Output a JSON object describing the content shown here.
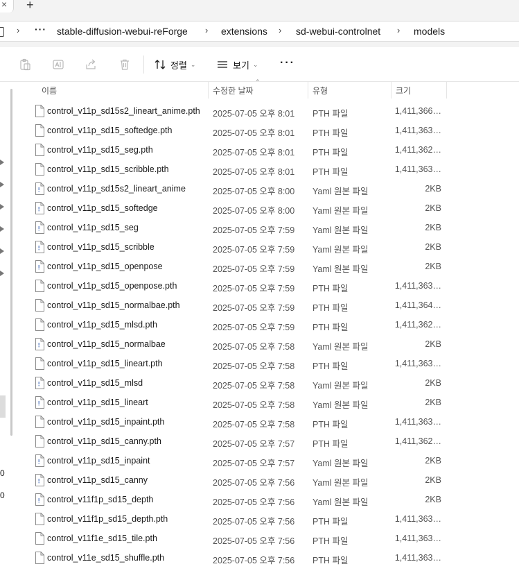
{
  "tabs": {
    "new_tab": "+",
    "close": "×"
  },
  "breadcrumb": {
    "overflow": "···",
    "items": [
      "stable-diffusion-webui-reForge",
      "extensions",
      "sd-webui-controlnet",
      "models"
    ]
  },
  "toolbar": {
    "sort_label": "정렬",
    "view_label": "보기",
    "more": "···"
  },
  "nav": {
    "digits": [
      "0",
      "0"
    ]
  },
  "columns": {
    "name": "이름",
    "date": "수정한 날짜",
    "type": "유형",
    "size": "크기"
  },
  "files": [
    {
      "name": "control_v11p_sd15s2_lineart_anime.pth",
      "date": "2025-07-05 오후 8:01",
      "type": "PTH 파일",
      "size": "1,411,366…",
      "kind": "pth"
    },
    {
      "name": "control_v11p_sd15_softedge.pth",
      "date": "2025-07-05 오후 8:01",
      "type": "PTH 파일",
      "size": "1,411,363…",
      "kind": "pth"
    },
    {
      "name": "control_v11p_sd15_seg.pth",
      "date": "2025-07-05 오후 8:01",
      "type": "PTH 파일",
      "size": "1,411,362…",
      "kind": "pth"
    },
    {
      "name": "control_v11p_sd15_scribble.pth",
      "date": "2025-07-05 오후 8:01",
      "type": "PTH 파일",
      "size": "1,411,363…",
      "kind": "pth"
    },
    {
      "name": "control_v11p_sd15s2_lineart_anime",
      "date": "2025-07-05 오후 8:00",
      "type": "Yaml 원본 파일",
      "size": "2KB",
      "kind": "yaml"
    },
    {
      "name": "control_v11p_sd15_softedge",
      "date": "2025-07-05 오후 8:00",
      "type": "Yaml 원본 파일",
      "size": "2KB",
      "kind": "yaml"
    },
    {
      "name": "control_v11p_sd15_seg",
      "date": "2025-07-05 오후 7:59",
      "type": "Yaml 원본 파일",
      "size": "2KB",
      "kind": "yaml"
    },
    {
      "name": "control_v11p_sd15_scribble",
      "date": "2025-07-05 오후 7:59",
      "type": "Yaml 원본 파일",
      "size": "2KB",
      "kind": "yaml"
    },
    {
      "name": "control_v11p_sd15_openpose",
      "date": "2025-07-05 오후 7:59",
      "type": "Yaml 원본 파일",
      "size": "2KB",
      "kind": "yaml"
    },
    {
      "name": "control_v11p_sd15_openpose.pth",
      "date": "2025-07-05 오후 7:59",
      "type": "PTH 파일",
      "size": "1,411,363…",
      "kind": "pth"
    },
    {
      "name": "control_v11p_sd15_normalbae.pth",
      "date": "2025-07-05 오후 7:59",
      "type": "PTH 파일",
      "size": "1,411,364…",
      "kind": "pth"
    },
    {
      "name": "control_v11p_sd15_mlsd.pth",
      "date": "2025-07-05 오후 7:59",
      "type": "PTH 파일",
      "size": "1,411,362…",
      "kind": "pth"
    },
    {
      "name": "control_v11p_sd15_normalbae",
      "date": "2025-07-05 오후 7:58",
      "type": "Yaml 원본 파일",
      "size": "2KB",
      "kind": "yaml"
    },
    {
      "name": "control_v11p_sd15_lineart.pth",
      "date": "2025-07-05 오후 7:58",
      "type": "PTH 파일",
      "size": "1,411,363…",
      "kind": "pth"
    },
    {
      "name": "control_v11p_sd15_mlsd",
      "date": "2025-07-05 오후 7:58",
      "type": "Yaml 원본 파일",
      "size": "2KB",
      "kind": "yaml"
    },
    {
      "name": "control_v11p_sd15_lineart",
      "date": "2025-07-05 오후 7:58",
      "type": "Yaml 원본 파일",
      "size": "2KB",
      "kind": "yaml"
    },
    {
      "name": "control_v11p_sd15_inpaint.pth",
      "date": "2025-07-05 오후 7:58",
      "type": "PTH 파일",
      "size": "1,411,363…",
      "kind": "pth"
    },
    {
      "name": "control_v11p_sd15_canny.pth",
      "date": "2025-07-05 오후 7:57",
      "type": "PTH 파일",
      "size": "1,411,362…",
      "kind": "pth"
    },
    {
      "name": "control_v11p_sd15_inpaint",
      "date": "2025-07-05 오후 7:57",
      "type": "Yaml 원본 파일",
      "size": "2KB",
      "kind": "yaml"
    },
    {
      "name": "control_v11p_sd15_canny",
      "date": "2025-07-05 오후 7:56",
      "type": "Yaml 원본 파일",
      "size": "2KB",
      "kind": "yaml"
    },
    {
      "name": "control_v11f1p_sd15_depth",
      "date": "2025-07-05 오후 7:56",
      "type": "Yaml 원본 파일",
      "size": "2KB",
      "kind": "yaml"
    },
    {
      "name": "control_v11f1p_sd15_depth.pth",
      "date": "2025-07-05 오후 7:56",
      "type": "PTH 파일",
      "size": "1,411,363…",
      "kind": "pth"
    },
    {
      "name": "control_v11f1e_sd15_tile.pth",
      "date": "2025-07-05 오후 7:56",
      "type": "PTH 파일",
      "size": "1,411,363…",
      "kind": "pth"
    },
    {
      "name": "control_v11e_sd15_shuffle.pth",
      "date": "2025-07-05 오후 7:56",
      "type": "PTH 파일",
      "size": "1,411,363…",
      "kind": "pth"
    }
  ]
}
